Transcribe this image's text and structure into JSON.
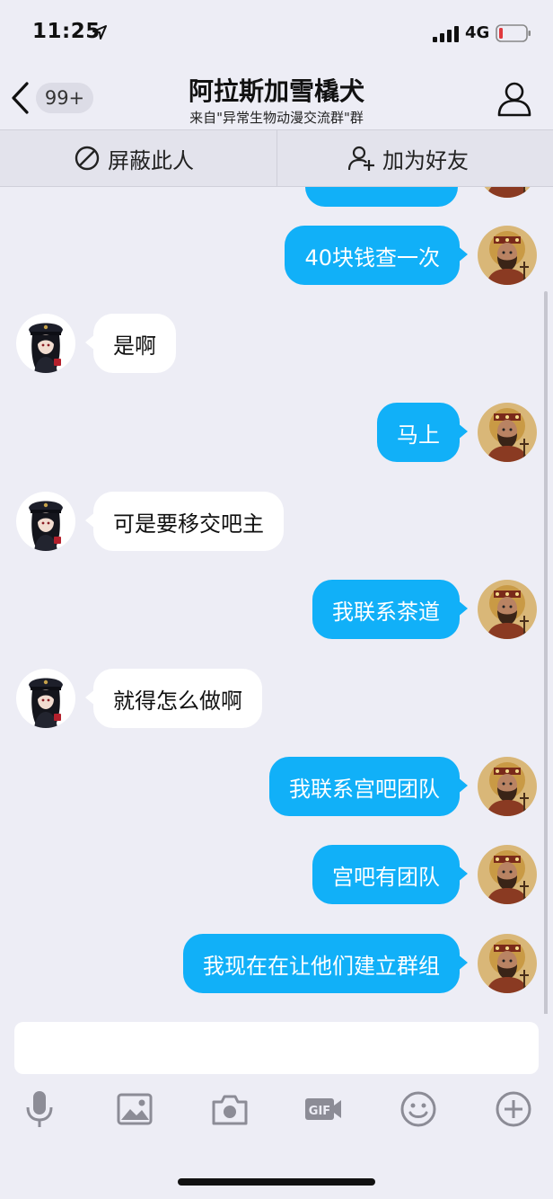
{
  "status": {
    "time": "11:25",
    "network": "4G"
  },
  "header": {
    "unread_count": "99+",
    "title": "阿拉斯加雪橇犬",
    "subtitle": "来自\"异常生物动漫交流群\"群"
  },
  "actions": {
    "block_label": "屏蔽此人",
    "add_friend_label": "加为好友"
  },
  "messages": [
    {
      "direction": "out",
      "text": "40块钱查一次"
    },
    {
      "direction": "in",
      "text": "是啊"
    },
    {
      "direction": "out",
      "text": "马上"
    },
    {
      "direction": "in",
      "text": "可是要移交吧主"
    },
    {
      "direction": "out",
      "text": "我联系茶道"
    },
    {
      "direction": "in",
      "text": "就得怎么做啊"
    },
    {
      "direction": "out",
      "text": "我联系宫吧团队"
    },
    {
      "direction": "out",
      "text": "宫吧有团队"
    },
    {
      "direction": "out",
      "text": "我现在在让他们建立群组"
    }
  ],
  "input": {
    "value": ""
  },
  "toolbar": [
    "microphone-icon",
    "image-icon",
    "camera-icon",
    "gif-icon",
    "emoji-icon",
    "plus-icon"
  ],
  "colors": {
    "outgoing_bubble": "#11b0f8",
    "incoming_bubble": "#ffffff",
    "background": "#ededf5"
  }
}
